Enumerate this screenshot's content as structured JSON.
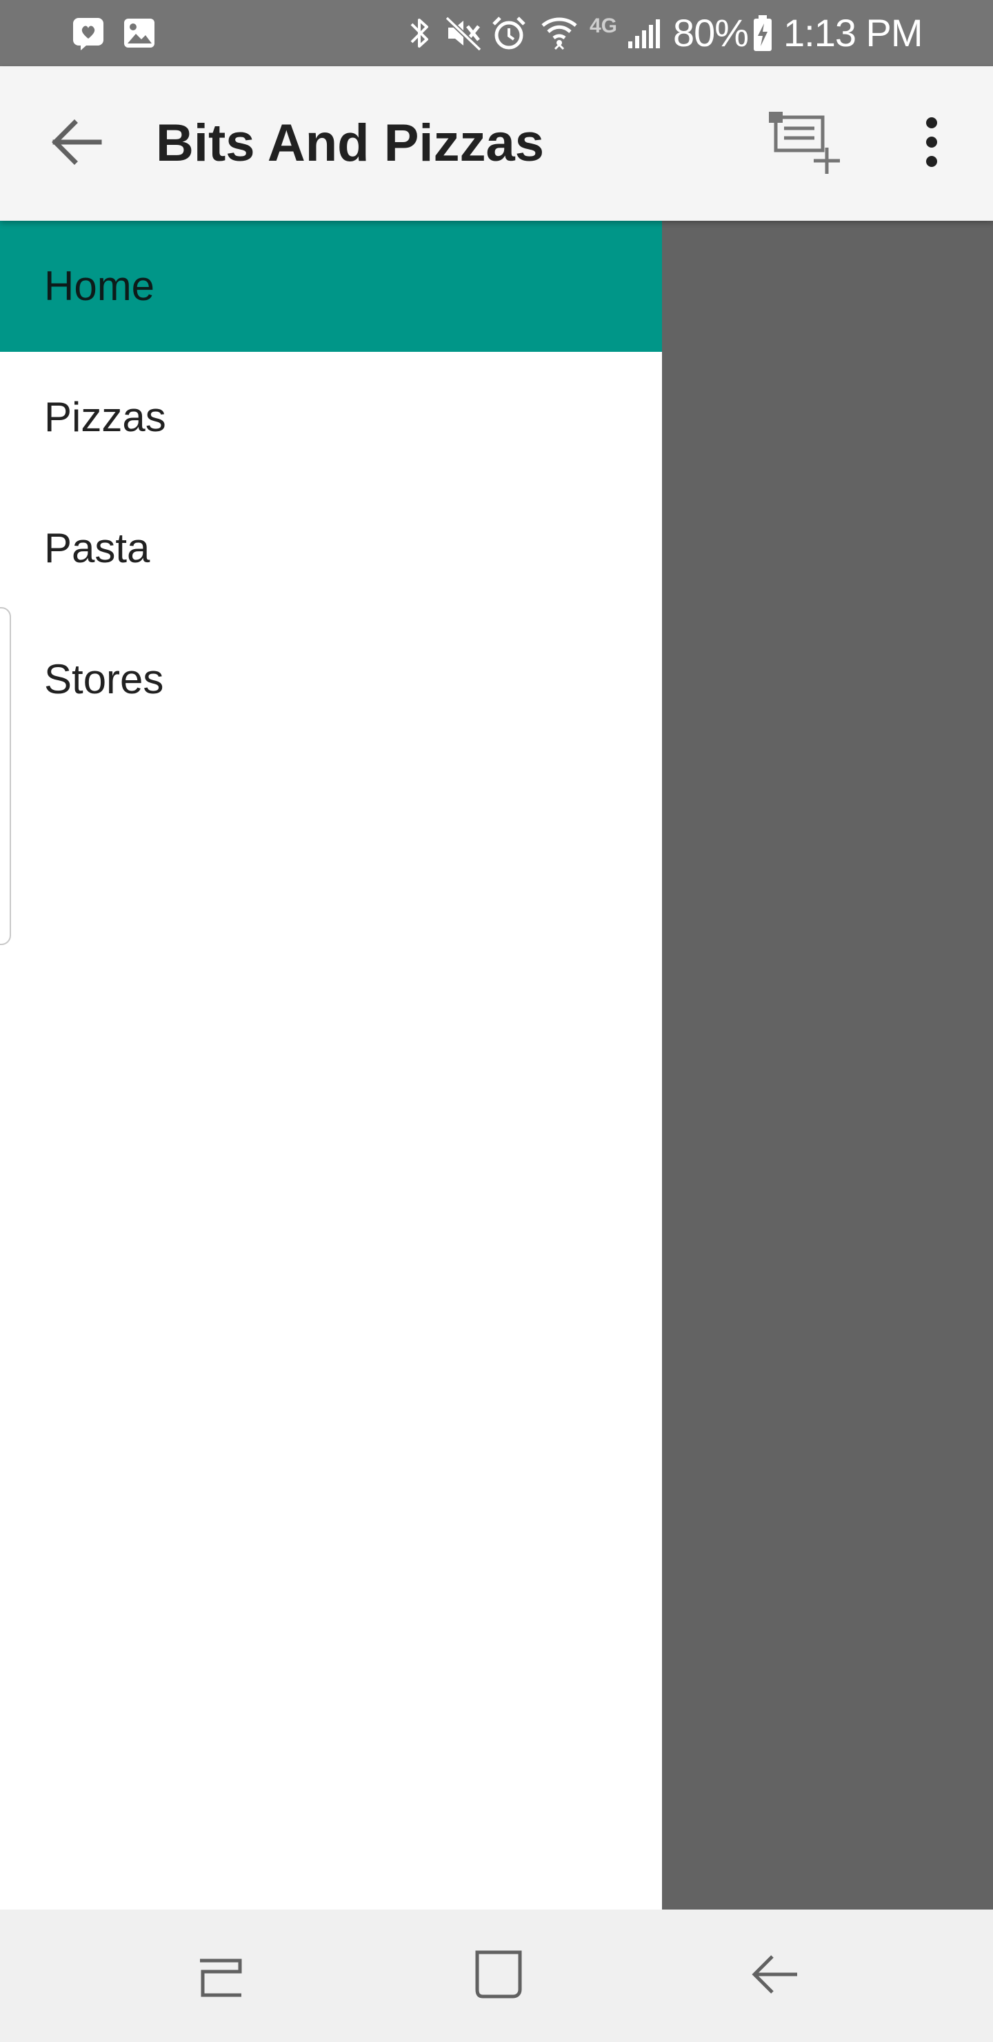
{
  "status_bar": {
    "left_icons": [
      "messenger-icon",
      "gallery-icon"
    ],
    "right_icons": [
      "bluetooth-icon",
      "mute-icon",
      "alarm-icon",
      "wifi-icon",
      "lte-icon",
      "signal-icon",
      "battery-charging-icon"
    ],
    "network_label": "4G",
    "battery": "80%",
    "time": "1:13 PM"
  },
  "app_bar": {
    "title": "Bits And Pizzas",
    "back_icon": "arrow-back-icon",
    "actions": [
      "create-order-icon",
      "more-vert-icon"
    ]
  },
  "drawer": {
    "items": [
      {
        "label": "Home",
        "active": true
      },
      {
        "label": "Pizzas",
        "active": false
      },
      {
        "label": "Pasta",
        "active": false
      },
      {
        "label": "Stores",
        "active": false
      }
    ]
  },
  "nav_bar": {
    "buttons": [
      "recents-icon",
      "home-icon",
      "back-icon"
    ]
  },
  "colors": {
    "status_bar": "#757575",
    "app_bar": "#f5f5f5",
    "accent": "#009688",
    "scrim": "#636363",
    "nav_bar": "#f0f0f0"
  }
}
